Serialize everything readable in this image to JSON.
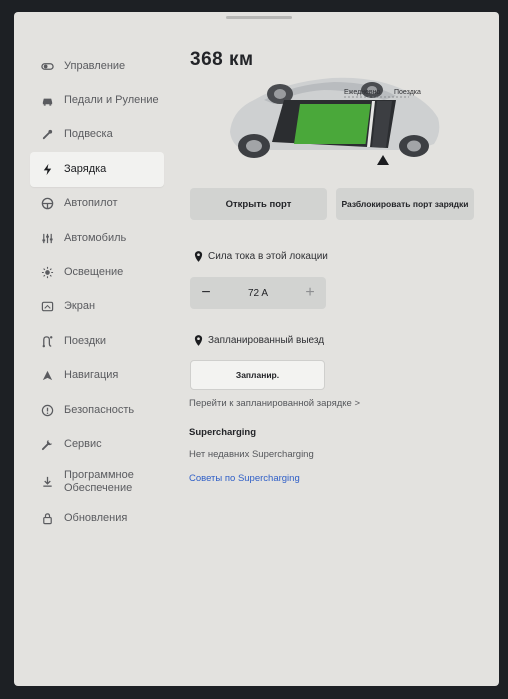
{
  "sidebar": {
    "items": [
      {
        "label": "Управление",
        "icon": "toggle-icon"
      },
      {
        "label": "Педали и Руление",
        "icon": "car-icon"
      },
      {
        "label": "Подвеска",
        "icon": "wrench-icon"
      },
      {
        "label": "Зарядка",
        "icon": "bolt-icon",
        "active": true
      },
      {
        "label": "Автопилот",
        "icon": "steering-wheel-icon"
      },
      {
        "label": "Автомобиль",
        "icon": "sliders-icon"
      },
      {
        "label": "Освещение",
        "icon": "sun-icon"
      },
      {
        "label": "Экран",
        "icon": "display-icon"
      },
      {
        "label": "Поездки",
        "icon": "route-icon"
      },
      {
        "label": "Навигация",
        "icon": "navigation-arrow-icon"
      },
      {
        "label": "Безопасность",
        "icon": "alert-circle-icon"
      },
      {
        "label": "Сервис",
        "icon": "service-wrench-icon"
      },
      {
        "label": "Программное Обеспечение",
        "label_line1": "Программное",
        "label_line2": "Обеспечение",
        "icon": "download-icon"
      },
      {
        "label": "Обновления",
        "icon": "lock-icon"
      }
    ]
  },
  "charging": {
    "range": "368 км",
    "charge_limit_level": 0.72,
    "limit_labels": {
      "daily": "Ежедневно",
      "trip": "Поездка"
    },
    "open_port_label": "Открыть порт",
    "unlock_port_label": "Разблокировать порт зарядки",
    "current_title": "Сила тока в этой локации",
    "current_value": "72 A",
    "minus_label": "−",
    "plus_label": "+",
    "scheduled_title": "Запланированный выезд",
    "schedule_button": "Запланир.",
    "scheduled_link": "Перейти к запланированной зарядке >",
    "supercharging_title": "Supercharging",
    "supercharging_none": "Нет недавних Supercharging",
    "supercharging_tips": "Советы по Supercharging"
  },
  "colors": {
    "battery_green": "#4aa83a",
    "link_blue": "#2f5fc7",
    "active_bg": "#f2f2f0"
  }
}
